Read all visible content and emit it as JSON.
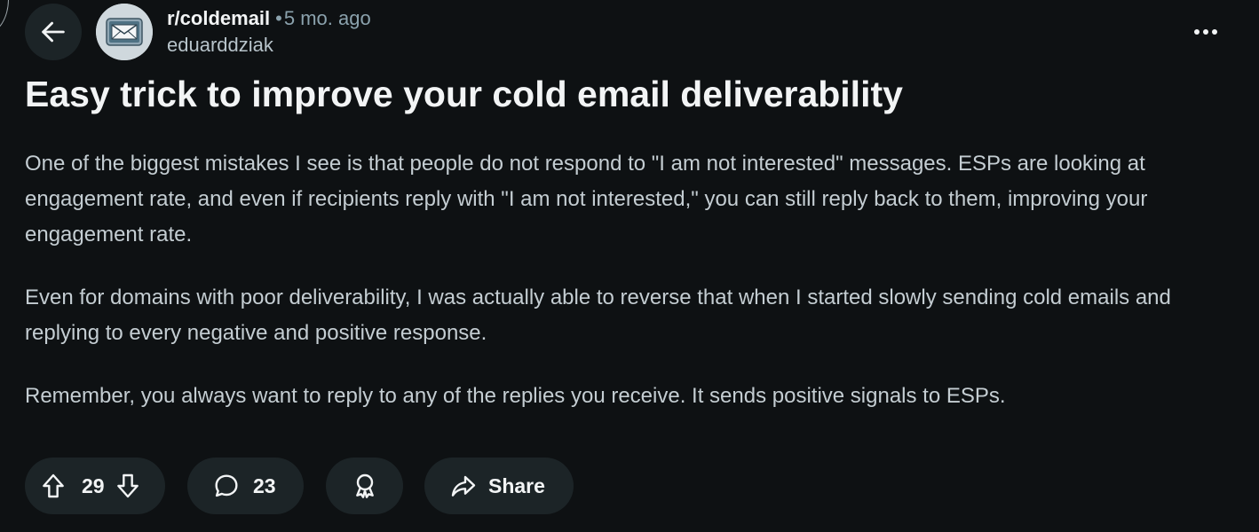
{
  "header": {
    "subreddit": "r/coldemail",
    "separator": "•",
    "age": "5 mo. ago",
    "author": "eduarddziak",
    "back_icon": "arrow-left-icon",
    "more_icon": "more-horizontal-icon",
    "avatar_icon": "envelope-avatar"
  },
  "post": {
    "title": "Easy trick to improve your cold email deliverability",
    "paragraphs": [
      "One of the biggest mistakes I see is that people do not respond to \"I am not interested\" messages. ESPs are looking at engagement rate, and even if recipients reply with \"I am not interested,\" you can still reply back to them, improving your engagement rate.",
      "Even for domains with poor deliverability, I was actually able to reverse that when I started slowly sending cold emails and replying to every negative and positive response.",
      "Remember, you always want to reply to any of the replies you receive. It sends positive signals to ESPs."
    ]
  },
  "actions": {
    "vote_count": "29",
    "comment_count": "23",
    "share_label": "Share",
    "upvote_icon": "arrow-up-icon",
    "downvote_icon": "arrow-down-icon",
    "comment_icon": "speech-bubble-icon",
    "award_icon": "award-ribbon-icon",
    "share_icon": "share-arrow-icon"
  },
  "colors": {
    "background": "#0e1113",
    "pill": "#1c2427",
    "text": "#f2f4f5",
    "body_text": "#c4cdd2",
    "muted": "#8ba2ad"
  }
}
